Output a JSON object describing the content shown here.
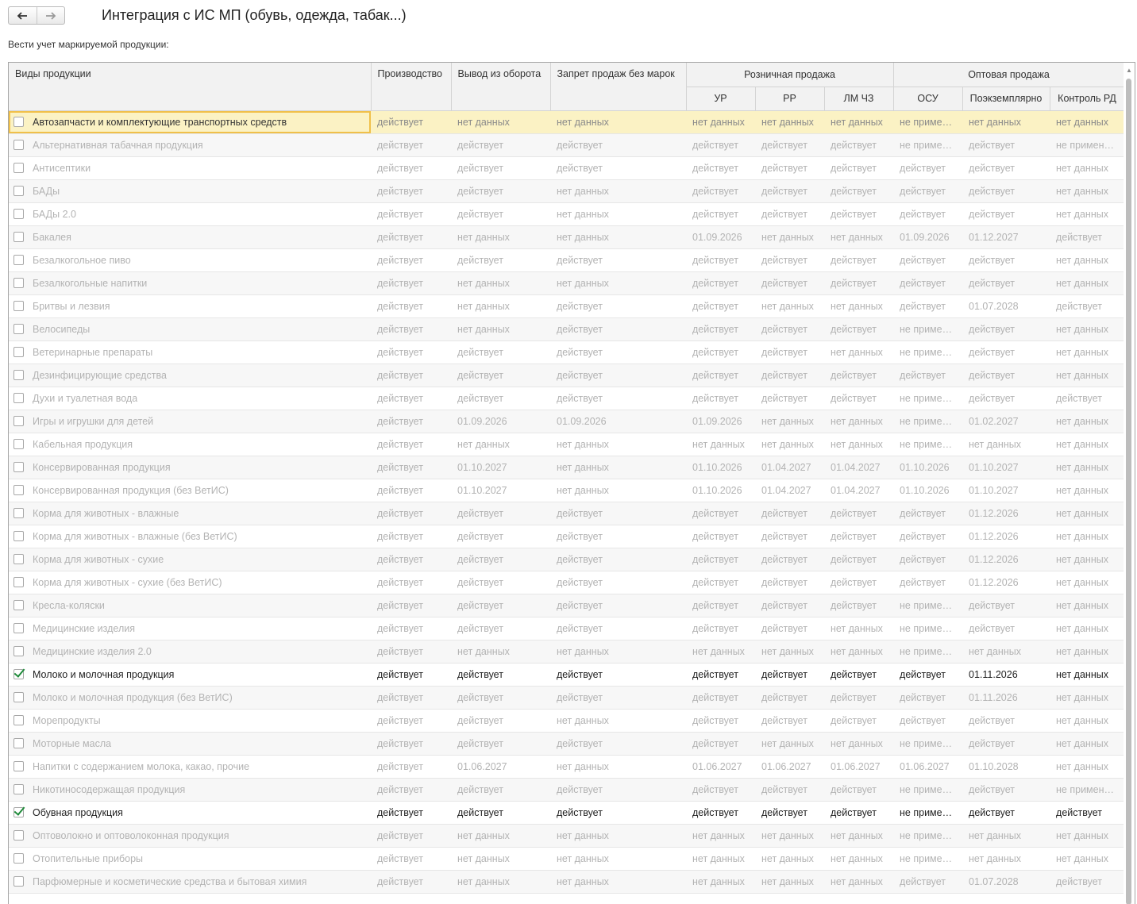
{
  "header": {
    "back_label": "←",
    "forward_label": "→",
    "title": "Интеграция с ИС МП (обувь, одежда, табак...)",
    "subtitle": "Вести учет маркируемой продукции:"
  },
  "table": {
    "columns": {
      "name": "Виды продукции",
      "production": "Производство",
      "withdrawal": "Вывод из оборота",
      "ban": "Запрет продаж без марок",
      "retail": "Розничная продажа",
      "ur": "УР",
      "rr": "РР",
      "lm": "ЛМ ЧЗ",
      "wholesale": "Оптовая продажа",
      "osu": "ОСУ",
      "per_item": "Поэкземплярно",
      "rd": "Контроль РД"
    },
    "rows": [
      {
        "checked": false,
        "selected": true,
        "name": "Автозапчасти и комплектующие транспортных средств",
        "v": [
          "действует",
          "нет данных",
          "нет данных",
          "нет данных",
          "нет данных",
          "нет данных",
          "не применяется",
          "нет данных",
          "нет данных"
        ]
      },
      {
        "checked": false,
        "name": "Альтернативная табачная продукция",
        "v": [
          "действует",
          "действует",
          "действует",
          "действует",
          "действует",
          "действует",
          "не применяется",
          "действует",
          "не применяется"
        ]
      },
      {
        "checked": false,
        "name": "Антисептики",
        "v": [
          "действует",
          "действует",
          "действует",
          "действует",
          "действует",
          "действует",
          "действует",
          "действует",
          "нет данных"
        ]
      },
      {
        "checked": false,
        "name": "БАДы",
        "v": [
          "действует",
          "действует",
          "нет данных",
          "действует",
          "действует",
          "действует",
          "действует",
          "действует",
          "нет данных"
        ]
      },
      {
        "checked": false,
        "name": "БАДы 2.0",
        "v": [
          "действует",
          "действует",
          "нет данных",
          "действует",
          "действует",
          "действует",
          "действует",
          "действует",
          "нет данных"
        ]
      },
      {
        "checked": false,
        "name": "Бакалея",
        "v": [
          "действует",
          "нет данных",
          "нет данных",
          "01.09.2026",
          "нет данных",
          "нет данных",
          "01.09.2026",
          "01.12.2027",
          "действует"
        ]
      },
      {
        "checked": false,
        "name": "Безалкогольное пиво",
        "v": [
          "действует",
          "действует",
          "действует",
          "действует",
          "действует",
          "действует",
          "действует",
          "действует",
          "нет данных"
        ]
      },
      {
        "checked": false,
        "name": "Безалкогольные напитки",
        "v": [
          "действует",
          "нет данных",
          "нет данных",
          "действует",
          "действует",
          "действует",
          "действует",
          "действует",
          "нет данных"
        ]
      },
      {
        "checked": false,
        "name": "Бритвы и лезвия",
        "v": [
          "действует",
          "нет данных",
          "действует",
          "действует",
          "нет данных",
          "нет данных",
          "действует",
          "01.07.2028",
          "действует"
        ]
      },
      {
        "checked": false,
        "name": "Велосипеды",
        "v": [
          "действует",
          "нет данных",
          "действует",
          "действует",
          "действует",
          "действует",
          "не применяется",
          "действует",
          "нет данных"
        ]
      },
      {
        "checked": false,
        "name": "Ветеринарные препараты",
        "v": [
          "действует",
          "действует",
          "действует",
          "действует",
          "действует",
          "нет данных",
          "не применяется",
          "действует",
          "нет данных"
        ]
      },
      {
        "checked": false,
        "name": "Дезинфицирующие средства",
        "v": [
          "действует",
          "действует",
          "действует",
          "действует",
          "действует",
          "действует",
          "действует",
          "действует",
          "нет данных"
        ]
      },
      {
        "checked": false,
        "name": "Духи и туалетная вода",
        "v": [
          "действует",
          "действует",
          "действует",
          "действует",
          "действует",
          "действует",
          "не применяется",
          "действует",
          "действует"
        ]
      },
      {
        "checked": false,
        "name": "Игры и игрушки для детей",
        "v": [
          "действует",
          "01.09.2026",
          "01.09.2026",
          "01.09.2026",
          "нет данных",
          "нет данных",
          "не применяется",
          "01.02.2027",
          "нет данных"
        ]
      },
      {
        "checked": false,
        "name": "Кабельная продукция",
        "v": [
          "действует",
          "нет данных",
          "нет данных",
          "нет данных",
          "нет данных",
          "нет данных",
          "не применяется",
          "нет данных",
          "нет данных"
        ]
      },
      {
        "checked": false,
        "name": "Консервированная продукция",
        "v": [
          "действует",
          "01.10.2027",
          "нет данных",
          "01.10.2026",
          "01.04.2027",
          "01.04.2027",
          "01.10.2026",
          "01.10.2027",
          "нет данных"
        ]
      },
      {
        "checked": false,
        "name": "Консервированная продукция (без ВетИС)",
        "v": [
          "действует",
          "01.10.2027",
          "нет данных",
          "01.10.2026",
          "01.04.2027",
          "01.04.2027",
          "01.10.2026",
          "01.10.2027",
          "нет данных"
        ]
      },
      {
        "checked": false,
        "name": "Корма для животных - влажные",
        "v": [
          "действует",
          "действует",
          "действует",
          "действует",
          "действует",
          "действует",
          "действует",
          "01.12.2026",
          "нет данных"
        ]
      },
      {
        "checked": false,
        "name": "Корма для животных - влажные (без ВетИС)",
        "v": [
          "действует",
          "действует",
          "действует",
          "действует",
          "действует",
          "действует",
          "действует",
          "01.12.2026",
          "нет данных"
        ]
      },
      {
        "checked": false,
        "name": "Корма для животных - сухие",
        "v": [
          "действует",
          "действует",
          "действует",
          "действует",
          "действует",
          "действует",
          "действует",
          "01.12.2026",
          "нет данных"
        ]
      },
      {
        "checked": false,
        "name": "Корма для животных - сухие (без ВетИС)",
        "v": [
          "действует",
          "действует",
          "действует",
          "действует",
          "действует",
          "действует",
          "действует",
          "01.12.2026",
          "нет данных"
        ]
      },
      {
        "checked": false,
        "name": "Кресла-коляски",
        "v": [
          "действует",
          "действует",
          "действует",
          "действует",
          "действует",
          "действует",
          "не применяется",
          "действует",
          "нет данных"
        ]
      },
      {
        "checked": false,
        "name": "Медицинские изделия",
        "v": [
          "действует",
          "действует",
          "действует",
          "действует",
          "действует",
          "нет данных",
          "не применяется",
          "действует",
          "нет данных"
        ]
      },
      {
        "checked": false,
        "name": "Медицинские изделия 2.0",
        "v": [
          "действует",
          "нет данных",
          "нет данных",
          "нет данных",
          "нет данных",
          "нет данных",
          "не применяется",
          "нет данных",
          "нет данных"
        ]
      },
      {
        "checked": true,
        "name": "Молоко и молочная продукция",
        "v": [
          "действует",
          "действует",
          "действует",
          "действует",
          "действует",
          "действует",
          "действует",
          "01.11.2026",
          "нет данных"
        ]
      },
      {
        "checked": false,
        "name": "Молоко и молочная продукция (без ВетИС)",
        "v": [
          "действует",
          "действует",
          "действует",
          "действует",
          "действует",
          "действует",
          "действует",
          "01.11.2026",
          "нет данных"
        ]
      },
      {
        "checked": false,
        "name": "Морепродукты",
        "v": [
          "действует",
          "действует",
          "нет данных",
          "действует",
          "действует",
          "действует",
          "действует",
          "действует",
          "нет данных"
        ]
      },
      {
        "checked": false,
        "name": "Моторные масла",
        "v": [
          "действует",
          "действует",
          "действует",
          "действует",
          "нет данных",
          "нет данных",
          "не применяется",
          "действует",
          "нет данных"
        ]
      },
      {
        "checked": false,
        "name": "Напитки с содержанием молока, какао, прочие",
        "v": [
          "действует",
          "01.06.2027",
          "нет данных",
          "01.06.2027",
          "01.06.2027",
          "01.06.2027",
          "01.06.2027",
          "01.10.2028",
          "нет данных"
        ]
      },
      {
        "checked": false,
        "name": "Никотиносодержащая продукция",
        "v": [
          "действует",
          "действует",
          "действует",
          "действует",
          "действует",
          "действует",
          "не применяется",
          "действует",
          "не применяется"
        ]
      },
      {
        "checked": true,
        "name": "Обувная продукция",
        "v": [
          "действует",
          "действует",
          "действует",
          "действует",
          "действует",
          "действует",
          "не применяется",
          "действует",
          "действует"
        ]
      },
      {
        "checked": false,
        "name": "Оптоволокно и оптоволоконная продукция",
        "v": [
          "действует",
          "нет данных",
          "нет данных",
          "нет данных",
          "нет данных",
          "нет данных",
          "не применяется",
          "нет данных",
          "нет данных"
        ]
      },
      {
        "checked": false,
        "name": "Отопительные приборы",
        "v": [
          "действует",
          "нет данных",
          "нет данных",
          "нет данных",
          "нет данных",
          "нет данных",
          "не применяется",
          "нет данных",
          "нет данных"
        ]
      },
      {
        "checked": false,
        "name": "Парфюмерные и косметические средства и бытовая химия",
        "v": [
          "действует",
          "нет данных",
          "нет данных",
          "нет данных",
          "нет данных",
          "нет данных",
          "действует",
          "01.07.2028",
          "действует"
        ]
      }
    ]
  }
}
